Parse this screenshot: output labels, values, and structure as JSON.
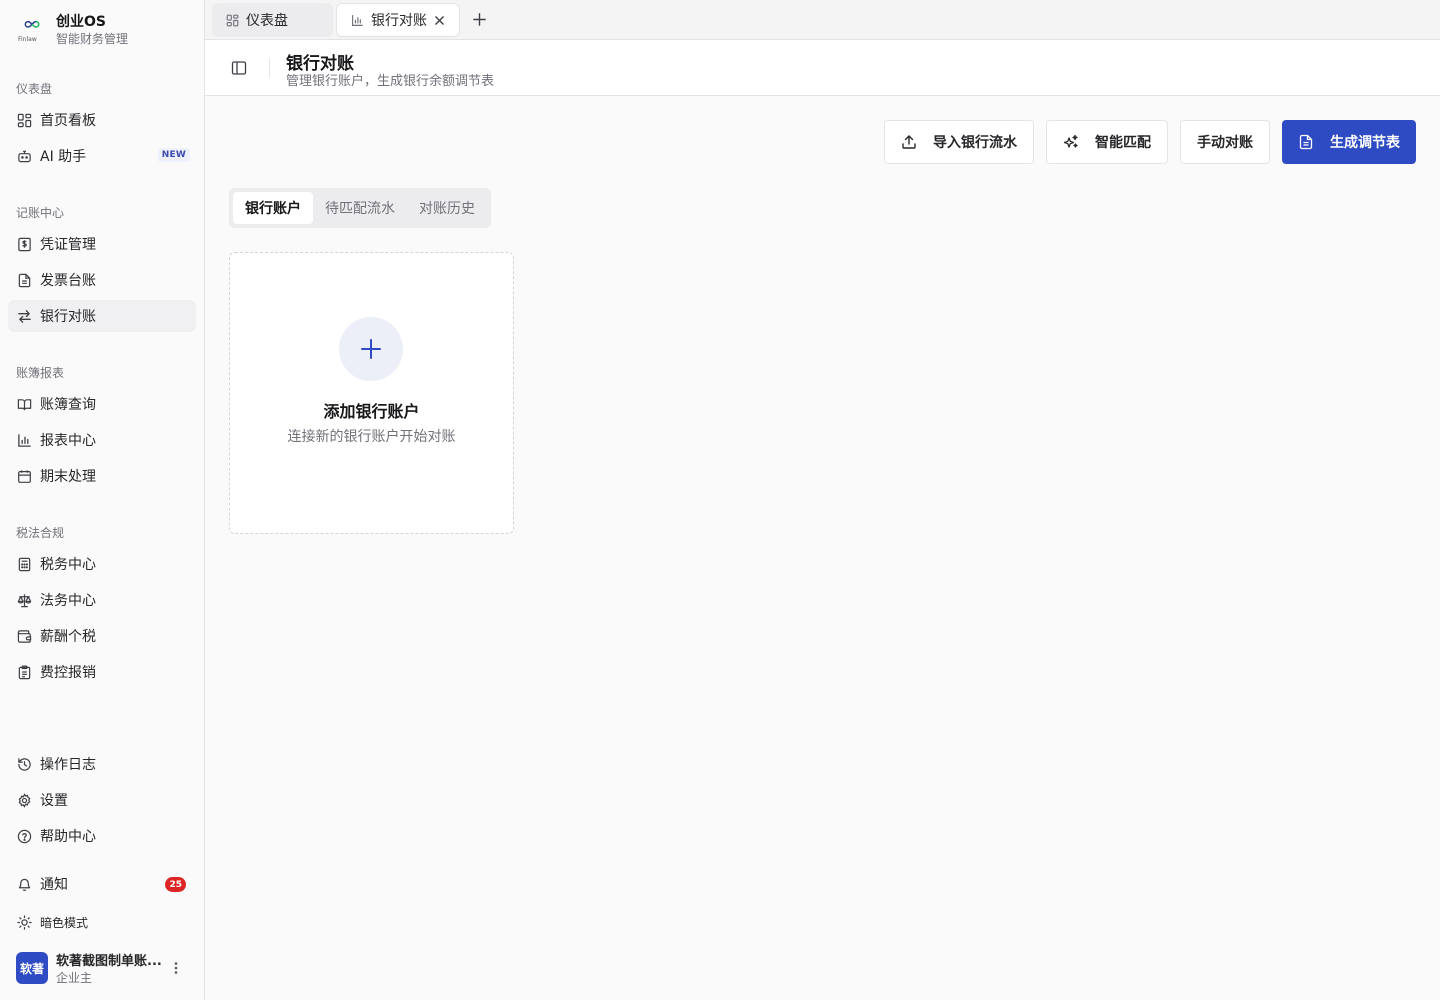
{
  "brand": {
    "name": "创业OS",
    "subtitle": "智能财务管理",
    "logo_caption": "Finlaw"
  },
  "sidebar": {
    "groups": [
      {
        "label": "仪表盘",
        "items": [
          {
            "label": "首页看板",
            "icon": "layout-grid-icon"
          },
          {
            "label": "AI 助手",
            "icon": "bot-icon",
            "badge": "NEW"
          }
        ]
      },
      {
        "label": "记账中心",
        "items": [
          {
            "label": "凭证管理",
            "icon": "receipt-icon"
          },
          {
            "label": "发票台账",
            "icon": "file-text-icon"
          },
          {
            "label": "银行对账",
            "icon": "arrows-swap-icon",
            "active": true
          }
        ]
      },
      {
        "label": "账簿报表",
        "items": [
          {
            "label": "账簿查询",
            "icon": "book-open-icon"
          },
          {
            "label": "报表中心",
            "icon": "bar-chart-icon"
          },
          {
            "label": "期末处理",
            "icon": "calendar-icon"
          }
        ]
      },
      {
        "label": "税法合规",
        "items": [
          {
            "label": "税务中心",
            "icon": "calculator-icon"
          },
          {
            "label": "法务中心",
            "icon": "scale-icon"
          },
          {
            "label": "薪酬个税",
            "icon": "wallet-icon"
          },
          {
            "label": "费控报销",
            "icon": "clipboard-icon"
          }
        ]
      }
    ],
    "bottom": [
      {
        "label": "操作日志",
        "icon": "history-icon"
      },
      {
        "label": "设置",
        "icon": "gear-icon"
      },
      {
        "label": "帮助中心",
        "icon": "help-circle-icon"
      },
      {
        "label": "通知",
        "icon": "bell-icon",
        "count": "25"
      },
      {
        "label": "暗色模式",
        "icon": "sun-icon"
      }
    ],
    "user": {
      "avatar_text": "软著",
      "name": "软著截图制单账...",
      "role": "企业主"
    }
  },
  "tabs": [
    {
      "label": "仪表盘",
      "icon": "layout-grid-icon",
      "active": false
    },
    {
      "label": "银行对账",
      "icon": "bar-chart-icon",
      "active": true
    }
  ],
  "header": {
    "title": "银行对账",
    "description": "管理银行账户，生成银行余额调节表"
  },
  "actions": {
    "import_label": "导入银行流水",
    "match_label": "智能匹配",
    "manual_label": "手动对账",
    "generate_label": "生成调节表"
  },
  "segments": [
    {
      "label": "银行账户",
      "active": true
    },
    {
      "label": "待匹配流水",
      "active": false
    },
    {
      "label": "对账历史",
      "active": false
    }
  ],
  "add_card": {
    "title": "添加银行账户",
    "description": "连接新的银行账户开始对账"
  },
  "colors": {
    "primary": "#2f4bc4",
    "badge_red": "#dc2626",
    "background": "#fafafa"
  }
}
